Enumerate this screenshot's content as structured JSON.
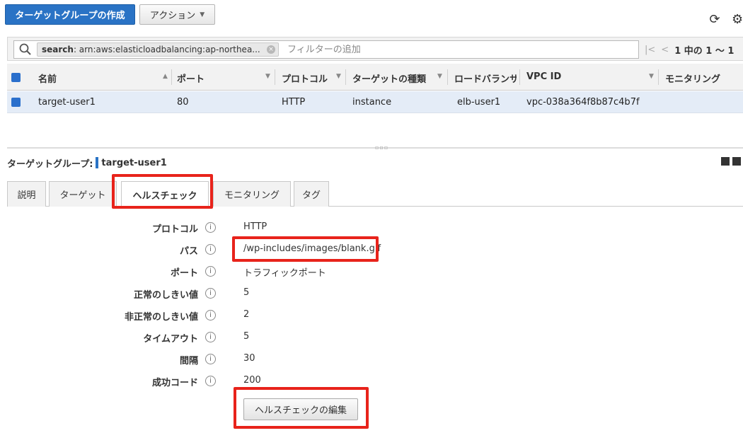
{
  "toolbar": {
    "create_label": "ターゲットグループの作成",
    "actions_label": "アクション",
    "refresh_icon": "refresh-icon",
    "settings_icon": "gear-icon"
  },
  "filter": {
    "token_key": "search",
    "token_value": ": arn:aws:elasticloadbalancing:ap-northea...",
    "placeholder": "フィルターの追加",
    "pager_text": "1 中の 1 ～ 1"
  },
  "table": {
    "headers": [
      "名前",
      "ポート",
      "プロトコル",
      "ターゲットの種類",
      "ロードバランサー",
      "VPC ID",
      "モニタリング"
    ],
    "rows": [
      {
        "name": "target-user1",
        "port": "80",
        "protocol": "HTTP",
        "target_type": "instance",
        "load_balancer": "elb-user1",
        "vpc_id": "vpc-038a364f8b87c4b7f",
        "monitoring": ""
      }
    ]
  },
  "detail": {
    "title_prefix": "ターゲットグループ:",
    "title_name": "target-user1",
    "tabs": [
      "説明",
      "ターゲット",
      "ヘルスチェック",
      "モニタリング",
      "タグ"
    ],
    "active_tab": "ヘルスチェック",
    "rows": [
      {
        "label": "プロトコル",
        "value": "HTTP"
      },
      {
        "label": "パス",
        "value": "/wp-includes/images/blank.gif"
      },
      {
        "label": "ポート",
        "value": "トラフィックポート"
      },
      {
        "label": "正常のしきい値",
        "value": "5"
      },
      {
        "label": "非正常のしきい値",
        "value": "2"
      },
      {
        "label": "タイムアウト",
        "value": "5"
      },
      {
        "label": "間隔",
        "value": "30"
      },
      {
        "label": "成功コード",
        "value": "200"
      }
    ],
    "edit_label": "ヘルスチェックの編集",
    "info_glyph": "i"
  },
  "colors": {
    "primary": "#2a73c5",
    "selected_row": "#e4ecf7",
    "highlight": "#e8231b"
  }
}
